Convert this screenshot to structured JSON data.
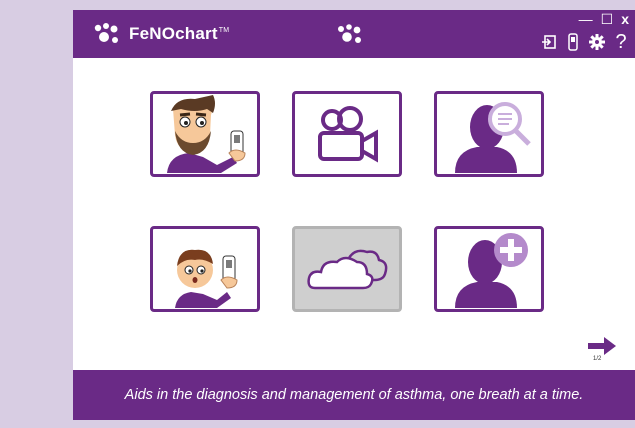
{
  "app": {
    "name": "FeNOchart",
    "trademark": "TM",
    "window_controls": {
      "minimize": "—",
      "maximize": "☐",
      "close": "x"
    },
    "toolbar_help": "?"
  },
  "tiles": [
    {
      "name": "adult-patient-test",
      "disabled": false
    },
    {
      "name": "video-tutorials",
      "disabled": false
    },
    {
      "name": "search-patient",
      "disabled": false
    },
    {
      "name": "child-patient-test",
      "disabled": false
    },
    {
      "name": "cloud-sync",
      "disabled": true
    },
    {
      "name": "add-patient",
      "disabled": false
    }
  ],
  "pagination": {
    "indicator": "1/2"
  },
  "footer": {
    "tagline": "Aids in the diagnosis and management of asthma, one breath at a time."
  },
  "colors": {
    "brand": "#6a2a86",
    "background": "#d8cde3",
    "disabled_tile": "#cfcfcf"
  }
}
